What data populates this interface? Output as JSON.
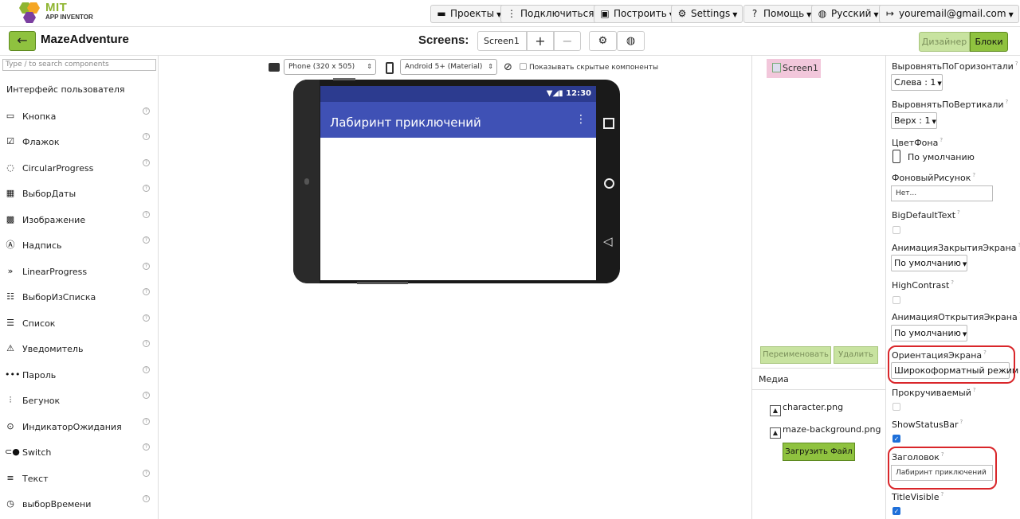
{
  "logo": {
    "brand": "MIT",
    "sub": "APP INVENTOR"
  },
  "menus": [
    {
      "label": "Проекты",
      "icon": "folder-icon"
    },
    {
      "label": "Подключиться",
      "icon": "connect-icon"
    },
    {
      "label": "Построить",
      "icon": "build-icon"
    },
    {
      "label": "Settings",
      "icon": "gear-icon"
    },
    {
      "label": "Помощь",
      "icon": "help-icon"
    },
    {
      "label": "Русский",
      "icon": "globe-icon"
    },
    {
      "label": "youremail@gmail.com",
      "icon": "signout-icon"
    }
  ],
  "project": {
    "title": "MazeAdventure",
    "back": "←"
  },
  "screens": {
    "label": "Screens:",
    "current": "Screen1",
    "add": "+",
    "remove": "−"
  },
  "mode": {
    "designer": "Дизайнер",
    "blocks": "Блоки"
  },
  "palette": {
    "search_placeholder": "Type / to search components",
    "category": "Интерфейс пользователя",
    "items": [
      {
        "label": "Кнопка",
        "icon": "button-icon"
      },
      {
        "label": "Флажок",
        "icon": "checkbox-icon"
      },
      {
        "label": "CircularProgress",
        "icon": "circular-progress-icon"
      },
      {
        "label": "ВыборДаты",
        "icon": "calendar-icon"
      },
      {
        "label": "Изображение",
        "icon": "image-icon"
      },
      {
        "label": "Надпись",
        "icon": "label-icon"
      },
      {
        "label": "LinearProgress",
        "icon": "linear-progress-icon"
      },
      {
        "label": "ВыборИзСписка",
        "icon": "listpicker-icon"
      },
      {
        "label": "Список",
        "icon": "listview-icon"
      },
      {
        "label": "Уведомитель",
        "icon": "notifier-icon"
      },
      {
        "label": "Пароль",
        "icon": "password-icon"
      },
      {
        "label": "Бегунок",
        "icon": "slider-icon"
      },
      {
        "label": "ИндикаторОжидания",
        "icon": "spinner-icon"
      },
      {
        "label": "Switch",
        "icon": "switch-icon"
      },
      {
        "label": "Текст",
        "icon": "textbox-icon"
      },
      {
        "label": "выборВремени",
        "icon": "clock-icon"
      }
    ]
  },
  "viewer": {
    "device": "Phone (320 x 505)",
    "theme": "Android 5+ (Material)",
    "show_hidden": "Показывать скрытые компоненты",
    "time": "12:30",
    "app_title": "Лабиринт приключений"
  },
  "tree": {
    "root": "Screen1",
    "rename": "Переименовать",
    "delete": "Удалить"
  },
  "media": {
    "header": "Медиа",
    "files": [
      "character.png",
      "maze-background.png"
    ],
    "upload": "Загрузить Файл"
  },
  "properties": {
    "align_h": {
      "label": "ВыровнятьПоГоризонтали",
      "value": "Слева : 1"
    },
    "align_v": {
      "label": "ВыровнятьПоВертикали",
      "value": "Верх : 1"
    },
    "bg_color": {
      "label": "ЦветФона",
      "value": "По умолчанию"
    },
    "bg_image": {
      "label": "ФоновыйРисунок",
      "value": "Нет..."
    },
    "big_text": {
      "label": "BigDefaultText",
      "checked": false
    },
    "close_anim": {
      "label": "АнимацияЗакрытияЭкрана",
      "value": "По умолчанию"
    },
    "high_contrast": {
      "label": "HighContrast",
      "checked": false
    },
    "open_anim": {
      "label": "АнимацияОткрытияЭкрана",
      "value": "По умолчанию"
    },
    "orientation": {
      "label": "ОриентацияЭкрана",
      "value": "Широкоформатный режим"
    },
    "scrollable": {
      "label": "Прокручиваемый",
      "checked": false
    },
    "status_bar": {
      "label": "ShowStatusBar",
      "checked": true
    },
    "title": {
      "label": "Заголовок",
      "value": "Лабиринт приключений"
    },
    "title_visible": {
      "label": "TitleVisible",
      "checked": true
    }
  },
  "colors": {
    "accent_green": "#8fc23f",
    "appbar": "#3f51b5",
    "highlight": "#d9262a",
    "selected": "#f2c7db"
  }
}
